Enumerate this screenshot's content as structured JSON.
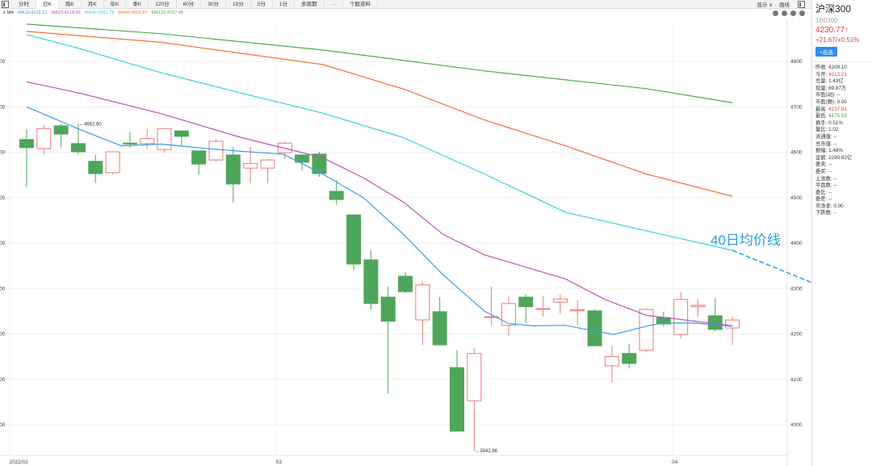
{
  "toolbar": {
    "tabs": [
      "分时",
      "日K",
      "周K",
      "月K",
      "年K",
      "季K",
      "120分",
      "60分",
      "30分",
      "15分",
      "5分",
      "1分",
      "多周期",
      "···",
      "个股资料"
    ],
    "active": 1,
    "display": "显示 ∨",
    "draw": "画线"
  },
  "ma_legend": {
    "toggle": "∨ MA",
    "items": [
      {
        "label": "MA10:4216.51",
        "color": "#3c9cf0"
      },
      {
        "label": "MA20:4218.66",
        "color": "#c050b8"
      },
      {
        "label": "MA40:4381.79",
        "color": "#3ccfe0"
      },
      {
        "label": "MA60:4501.87",
        "color": "#f57038"
      },
      {
        "label": "MA120:4707.45",
        "color": "#52a852"
      }
    ]
  },
  "sidebar": {
    "name": "沪深300",
    "code": "1B0300",
    "price": "4230.77↑",
    "change": "+21.67/+0.51%",
    "fav": "+自选",
    "stats": [
      {
        "k": "昨收:",
        "v": "4209.10",
        "c": ""
      },
      {
        "k": "今开:",
        "v": "4213.21",
        "c": "red"
      },
      {
        "k": "总量:",
        "v": "1.43亿",
        "c": ""
      },
      {
        "k": "现量:",
        "v": "69.87万",
        "c": ""
      },
      {
        "k": "市盈(动):",
        "v": "--",
        "c": ""
      },
      {
        "k": "市盈(静):",
        "v": "0.00",
        "c": ""
      },
      {
        "k": "最高:",
        "v": "4237.81",
        "c": "red"
      },
      {
        "k": "最低:",
        "v": "4175.53",
        "c": "green"
      },
      {
        "k": "换手:",
        "v": "0.51%",
        "c": ""
      },
      {
        "k": "量比:",
        "v": "1.02",
        "c": ""
      },
      {
        "k": "流通值:",
        "v": "--",
        "c": ""
      },
      {
        "k": "总市值:",
        "v": "--",
        "c": ""
      },
      {
        "k": "振幅:",
        "v": "1.48%",
        "c": ""
      },
      {
        "k": "金额:",
        "v": "2290.82亿",
        "c": ""
      },
      {
        "k": "委卖:",
        "v": "--",
        "c": ""
      },
      {
        "k": "委买:",
        "v": "--",
        "c": ""
      },
      {
        "k": "上涨数:",
        "v": "--",
        "c": ""
      },
      {
        "k": "平盘数:",
        "v": "--",
        "c": ""
      },
      {
        "k": "委比:",
        "v": "--",
        "c": ""
      },
      {
        "k": "委差:",
        "v": "--",
        "c": ""
      },
      {
        "k": "市净率:",
        "v": "0.00",
        "c": ""
      },
      {
        "k": "下跌数:",
        "v": "--",
        "c": "green"
      }
    ]
  },
  "chart_data": {
    "type": "candlestick",
    "y_ticks": [
      4000,
      4100,
      4200,
      4300,
      4400,
      4500,
      4600,
      4700,
      4800
    ],
    "x_labels": [
      {
        "i": -0.5,
        "label": "2022/02"
      },
      {
        "i": 15,
        "label": "03"
      },
      {
        "i": 38,
        "label": "04"
      }
    ],
    "colors": {
      "up": "#ef7a7e",
      "down": "#4ea65a"
    },
    "annotations": [
      {
        "i": 3,
        "price": 4662.6,
        "label": "←4662.60"
      },
      {
        "i": 26,
        "price": 3942.86,
        "label": "←3942.86"
      },
      {
        "label": "40日均价线",
        "color": "#2a9fe6"
      }
    ],
    "candles": [
      [
        4628,
        4651,
        4523,
        4610
      ],
      [
        4608,
        4660,
        4596,
        4652
      ],
      [
        4658,
        4662,
        4610,
        4640
      ],
      [
        4619,
        4662.6,
        4596,
        4601
      ],
      [
        4580,
        4594,
        4532,
        4553
      ],
      [
        4555,
        4602,
        4551,
        4601
      ],
      [
        4620,
        4644,
        4610,
        4618
      ],
      [
        4619,
        4651,
        4608,
        4630
      ],
      [
        4606,
        4652,
        4599,
        4652
      ],
      [
        4647,
        4648,
        4615,
        4635
      ],
      [
        4603,
        4604,
        4551,
        4574
      ],
      [
        4583,
        4628,
        4580,
        4624
      ],
      [
        4594,
        4612,
        4489,
        4530
      ],
      [
        4565,
        4612,
        4532,
        4575
      ],
      [
        4565,
        4585,
        4532,
        4583
      ],
      [
        4599,
        4624,
        4585,
        4620
      ],
      [
        4594,
        4596,
        4560,
        4578
      ],
      [
        4596,
        4601,
        4546,
        4553
      ],
      [
        4514,
        4539,
        4484,
        4496
      ],
      [
        4462,
        4463,
        4340,
        4354
      ],
      [
        4363,
        4384,
        4254,
        4267
      ],
      [
        4281,
        4304,
        4069,
        4228
      ],
      [
        4327,
        4336,
        4290,
        4293
      ],
      [
        4231,
        4316,
        4176,
        4308
      ],
      [
        4249,
        4281,
        4176,
        4176
      ],
      [
        4126,
        4164,
        3986,
        3986
      ],
      [
        4053,
        4169,
        3942.86,
        4157
      ],
      [
        4237,
        4304,
        4219,
        4238
      ],
      [
        4219,
        4284,
        4196,
        4267
      ],
      [
        4281,
        4288,
        4224,
        4260
      ],
      [
        4254,
        4283,
        4238,
        4256
      ],
      [
        4270,
        4288,
        4244,
        4277
      ],
      [
        4251,
        4274,
        4219,
        4253
      ],
      [
        4251,
        4254,
        4174,
        4174
      ],
      [
        4130,
        4174,
        4092,
        4150
      ],
      [
        4157,
        4178,
        4124,
        4135
      ],
      [
        4164,
        4256,
        4160,
        4254
      ],
      [
        4236,
        4249,
        4217,
        4222
      ],
      [
        4199,
        4292,
        4190,
        4276
      ],
      [
        4260,
        4277,
        4238,
        4263
      ],
      [
        4240,
        4279,
        4206,
        4210
      ],
      [
        4213.21,
        4237.81,
        4175.53,
        4230.77
      ]
    ],
    "ma": [
      {
        "name": "MA120",
        "color": "#52a852",
        "points": [
          [
            0,
            4882
          ],
          [
            7.8,
            4861
          ],
          [
            17.2,
            4825
          ],
          [
            26.6,
            4779
          ],
          [
            36,
            4740
          ],
          [
            41,
            4709
          ]
        ]
      },
      {
        "name": "MA60",
        "color": "#f57038",
        "points": [
          [
            0,
            4866
          ],
          [
            7.8,
            4842
          ],
          [
            17.2,
            4793
          ],
          [
            21.9,
            4739
          ],
          [
            26.6,
            4671
          ],
          [
            31.3,
            4614
          ],
          [
            36,
            4552
          ],
          [
            41,
            4503
          ]
        ]
      },
      {
        "name": "MA40",
        "color": "#3ccfe0",
        "points": [
          [
            0,
            4859
          ],
          [
            3.1,
            4828
          ],
          [
            7.8,
            4775
          ],
          [
            12.5,
            4730
          ],
          [
            17.2,
            4686
          ],
          [
            21.9,
            4632
          ],
          [
            26.6,
            4552
          ],
          [
            31.3,
            4468
          ],
          [
            36,
            4427
          ],
          [
            41,
            4384
          ]
        ],
        "projection": [
          [
            41,
            4384
          ],
          [
            49.2,
            4258
          ]
        ]
      },
      {
        "name": "MA20",
        "color": "#c050b8",
        "points": [
          [
            0,
            4755
          ],
          [
            3.1,
            4730
          ],
          [
            7.8,
            4685
          ],
          [
            12.5,
            4632
          ],
          [
            17.2,
            4588
          ],
          [
            19.6,
            4543
          ],
          [
            21.9,
            4490
          ],
          [
            24.2,
            4419
          ],
          [
            26.6,
            4374
          ],
          [
            31.3,
            4321
          ],
          [
            33.6,
            4276
          ],
          [
            36,
            4241
          ],
          [
            41,
            4218
          ]
        ]
      },
      {
        "name": "MA10",
        "color": "#3c9cf0",
        "points": [
          [
            0,
            4700
          ],
          [
            3.1,
            4650
          ],
          [
            5.5,
            4614
          ],
          [
            7.8,
            4618
          ],
          [
            10.2,
            4609
          ],
          [
            12.5,
            4602
          ],
          [
            14.9,
            4596
          ],
          [
            17.2,
            4552
          ],
          [
            19.6,
            4499
          ],
          [
            21.9,
            4419
          ],
          [
            24.2,
            4330
          ],
          [
            26.6,
            4250
          ],
          [
            28,
            4223
          ],
          [
            29.4,
            4218
          ],
          [
            31.3,
            4219
          ],
          [
            33.2,
            4205
          ],
          [
            34.1,
            4199
          ],
          [
            36,
            4217
          ],
          [
            36.9,
            4224
          ],
          [
            38.8,
            4224
          ],
          [
            41,
            4217
          ]
        ]
      }
    ]
  }
}
